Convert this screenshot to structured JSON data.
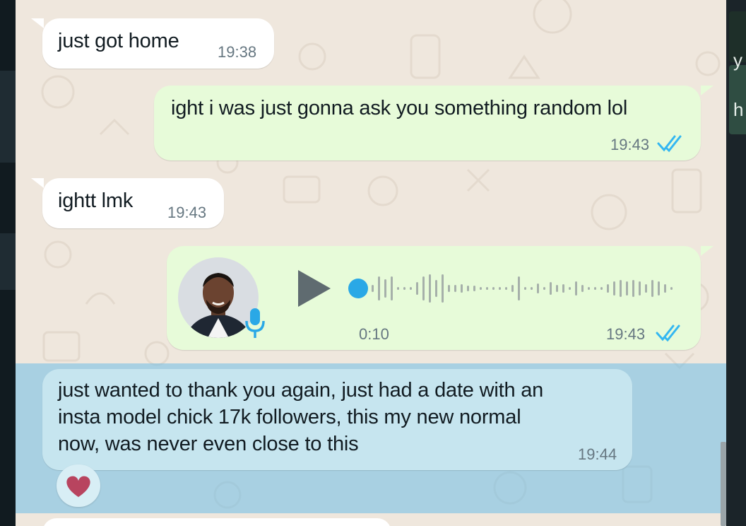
{
  "messages": [
    {
      "text": "just got home",
      "time": "19:38",
      "direction": "incoming"
    },
    {
      "text": "ight i was just gonna ask you something random lol",
      "time": "19:43",
      "direction": "outgoing",
      "status": "read"
    },
    {
      "text": "ightt lmk",
      "time": "19:43",
      "direction": "incoming"
    },
    {
      "type": "voice",
      "duration": "0:10",
      "time": "19:43",
      "direction": "outgoing",
      "status": "read",
      "playback_progress": 0
    },
    {
      "lines": [
        "just wanted to thank you again, just had a date with an",
        "insta model chick 17k followers, this my new normal",
        "now, was never even close to this"
      ],
      "time": "19:44",
      "direction": "incoming",
      "selected": true,
      "reaction": "heart"
    }
  ],
  "side_panel": {
    "visible_chars": [
      "y",
      "h"
    ]
  },
  "colors": {
    "wallpaper": "#efe7dd",
    "incoming_bubble": "#ffffff",
    "outgoing_bubble": "#e7fbd9",
    "read_ticks": "#34b7f1",
    "selection": "#9fd3ec",
    "mic_icon": "#2aa8e6"
  },
  "icons": [
    "read-receipt-icon",
    "play-icon",
    "microphone-icon",
    "heart-icon"
  ]
}
